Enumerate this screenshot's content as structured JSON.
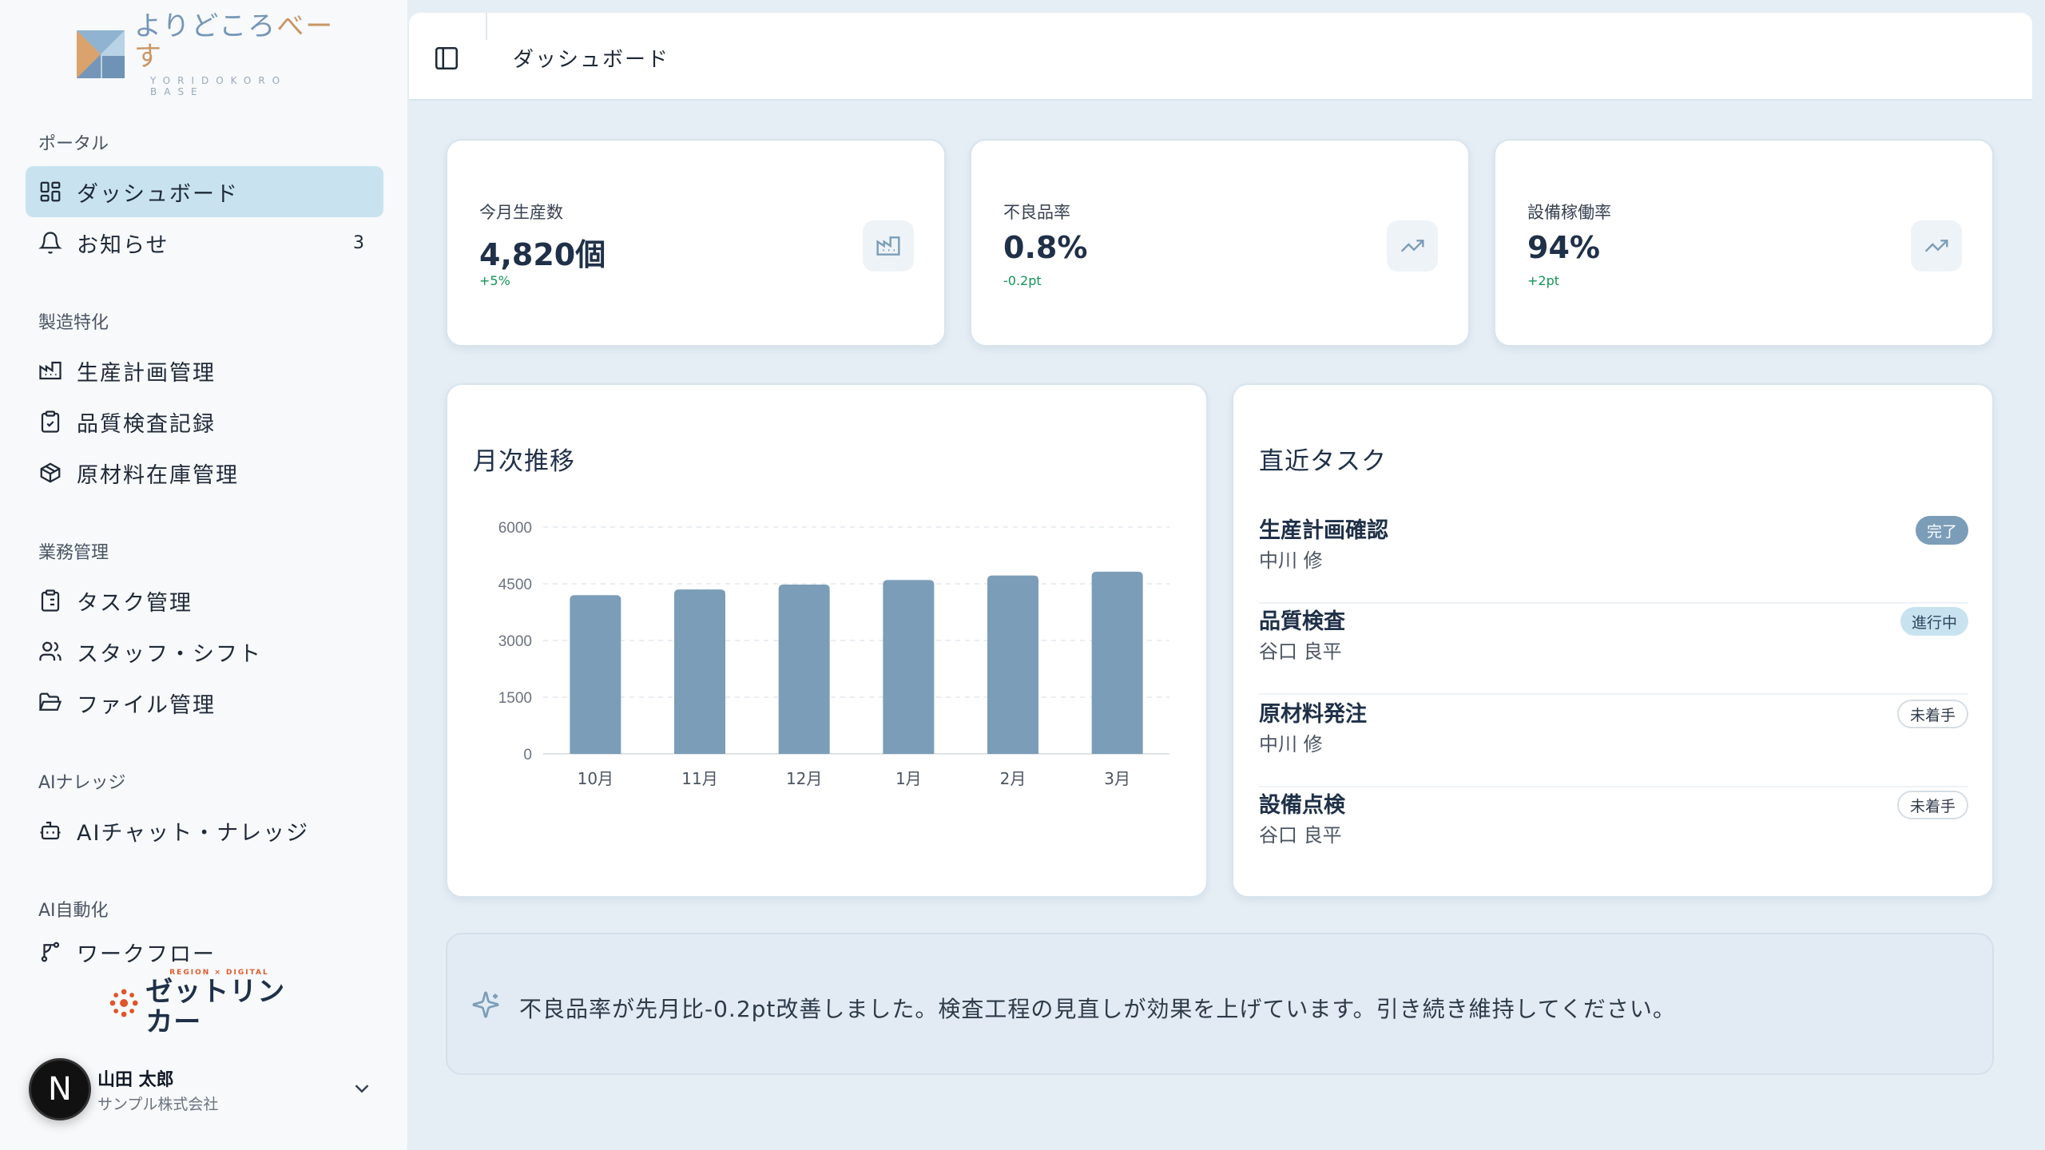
{
  "brand": {
    "title_part1": "よりどころ",
    "title_part2": "べーす",
    "subtitle": "YORIDOKORO BASE"
  },
  "sidebar": {
    "sections": [
      {
        "label": "ポータル"
      },
      {
        "label": "製造特化"
      },
      {
        "label": "業務管理"
      },
      {
        "label": "AIナレッジ"
      },
      {
        "label": "AI自動化"
      }
    ],
    "items": [
      {
        "label": "ダッシュボード",
        "icon": "dashboard-icon",
        "active": true
      },
      {
        "label": "お知らせ",
        "icon": "bell-icon",
        "badge": "3"
      },
      {
        "label": "生産計画管理",
        "icon": "factory-icon"
      },
      {
        "label": "品質検査記録",
        "icon": "clipboard-check-icon"
      },
      {
        "label": "原材料在庫管理",
        "icon": "package-icon"
      },
      {
        "label": "タスク管理",
        "icon": "clipboard-list-icon"
      },
      {
        "label": "スタッフ・シフト",
        "icon": "users-icon"
      },
      {
        "label": "ファイル管理",
        "icon": "folder-icon"
      },
      {
        "label": "AIチャット・ナレッジ",
        "icon": "bot-icon"
      },
      {
        "label": "ワークフロー",
        "icon": "workflow-icon"
      }
    ]
  },
  "partner": {
    "subtitle": "REGION × DIGITAL",
    "name": "ゼットリンカー"
  },
  "user": {
    "initial": "N",
    "name": "山田 太郎",
    "company": "サンプル株式会社"
  },
  "header": {
    "title": "ダッシュボード"
  },
  "stats": [
    {
      "label": "今月生産数",
      "value": "4,820個",
      "delta": "+5%",
      "icon": "factory-icon"
    },
    {
      "label": "不良品率",
      "value": "0.8%",
      "delta": "-0.2pt",
      "icon": "trending-up-icon"
    },
    {
      "label": "設備稼働率",
      "value": "94%",
      "delta": "+2pt",
      "icon": "trending-up-icon"
    }
  ],
  "chart_panel": {
    "title": "月次推移"
  },
  "chart_data": {
    "type": "bar",
    "title": "月次推移",
    "categories": [
      "10月",
      "11月",
      "12月",
      "1月",
      "2月",
      "3月"
    ],
    "values": [
      4200,
      4350,
      4480,
      4600,
      4720,
      4820
    ],
    "ylim": [
      0,
      6000
    ],
    "yticks": [
      "0",
      "1500",
      "3000",
      "4500",
      "6000"
    ],
    "grid": true,
    "bar_color": "#7b9db8"
  },
  "tasks_panel": {
    "title": "直近タスク",
    "tasks": [
      {
        "title": "生産計画確認",
        "person": "中川 修",
        "status": "完了",
        "status_type": "done"
      },
      {
        "title": "品質検査",
        "person": "谷口 良平",
        "status": "進行中",
        "status_type": "progress"
      },
      {
        "title": "原材料発注",
        "person": "中川 修",
        "status": "未着手",
        "status_type": "todo"
      },
      {
        "title": "設備点検",
        "person": "谷口 良平",
        "status": "未着手",
        "status_type": "todo"
      }
    ]
  },
  "insight": {
    "icon": "sparkles-icon",
    "text": "不良品率が先月比-0.2pt改善しました。検査工程の見直しが効果を上げています。引き続き維持してください。"
  },
  "colors": {
    "accent": "#7b9db8",
    "active_nav": "#c8e3ef",
    "positive": "#15935a"
  }
}
